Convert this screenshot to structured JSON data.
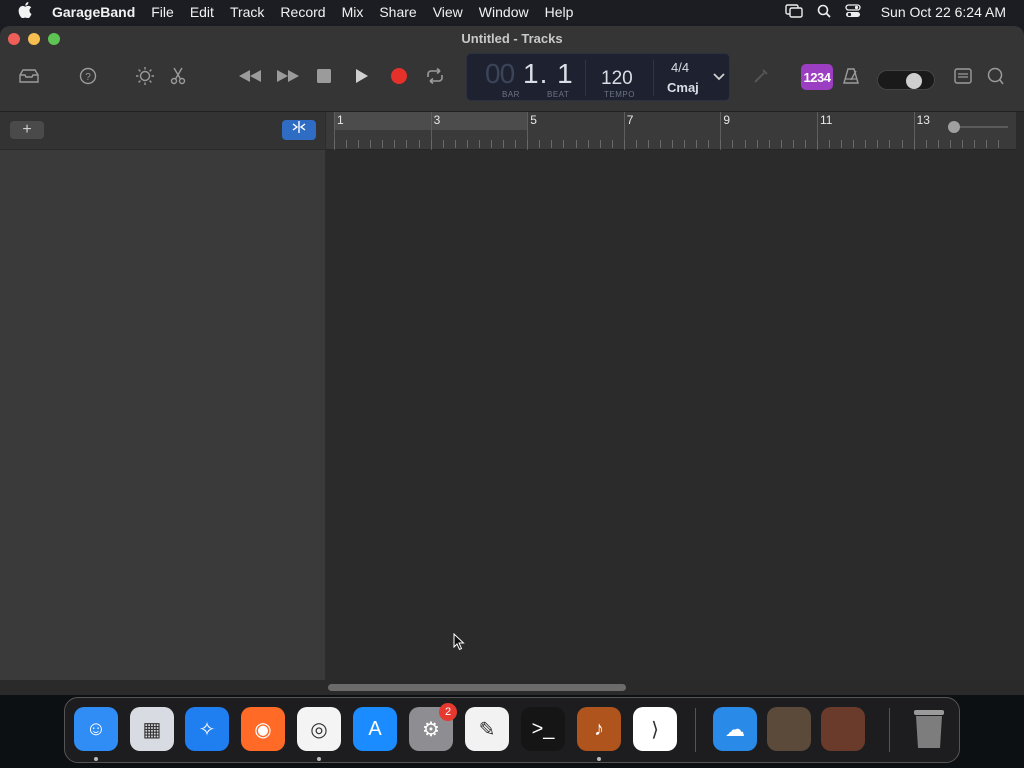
{
  "menubar": {
    "app_name": "GarageBand",
    "items": [
      "File",
      "Edit",
      "Track",
      "Record",
      "Mix",
      "Share",
      "View",
      "Window",
      "Help"
    ],
    "clock": "Sun Oct 22  6:24 AM"
  },
  "window": {
    "title": "Untitled - Tracks"
  },
  "lcd": {
    "bar_ghost": "00",
    "bar_value": "1. 1",
    "bar_label": "BAR",
    "beat_label": "BEAT",
    "tempo": "120",
    "tempo_label": "TEMPO",
    "time_signature": "4/4",
    "key": "Cmaj"
  },
  "count_in": "1234",
  "sidebar": {
    "add_label": "+",
    "filter_label": "⌖"
  },
  "ruler": {
    "bars": [
      "1",
      "3",
      "5",
      "7",
      "9",
      "11",
      "13"
    ]
  },
  "dock": {
    "apps": [
      {
        "name": "Finder",
        "color": "#2f8df5"
      },
      {
        "name": "Launchpad",
        "color": "#d9dbe2"
      },
      {
        "name": "Safari",
        "color": "#1f7ef0"
      },
      {
        "name": "Firefox",
        "color": "#ff6b26"
      },
      {
        "name": "Chrome",
        "color": "#f4f4f4"
      },
      {
        "name": "App Store",
        "color": "#1b8cff"
      },
      {
        "name": "System Settings",
        "color": "#8d8d92"
      },
      {
        "name": "TextEdit",
        "color": "#f2f2f2"
      },
      {
        "name": "Terminal",
        "color": "#151515"
      },
      {
        "name": "GarageBand",
        "color": "#b0541d"
      },
      {
        "name": "Visual Studio Code",
        "color": "#ffffff"
      },
      {
        "name": "Weather",
        "color": "#2a8ae8"
      }
    ],
    "settings_badge": "2"
  },
  "colors": {
    "accent_blue": "#2f6cc4",
    "count_in_purple": "#9b3ec1",
    "record_red": "#e5312a"
  }
}
